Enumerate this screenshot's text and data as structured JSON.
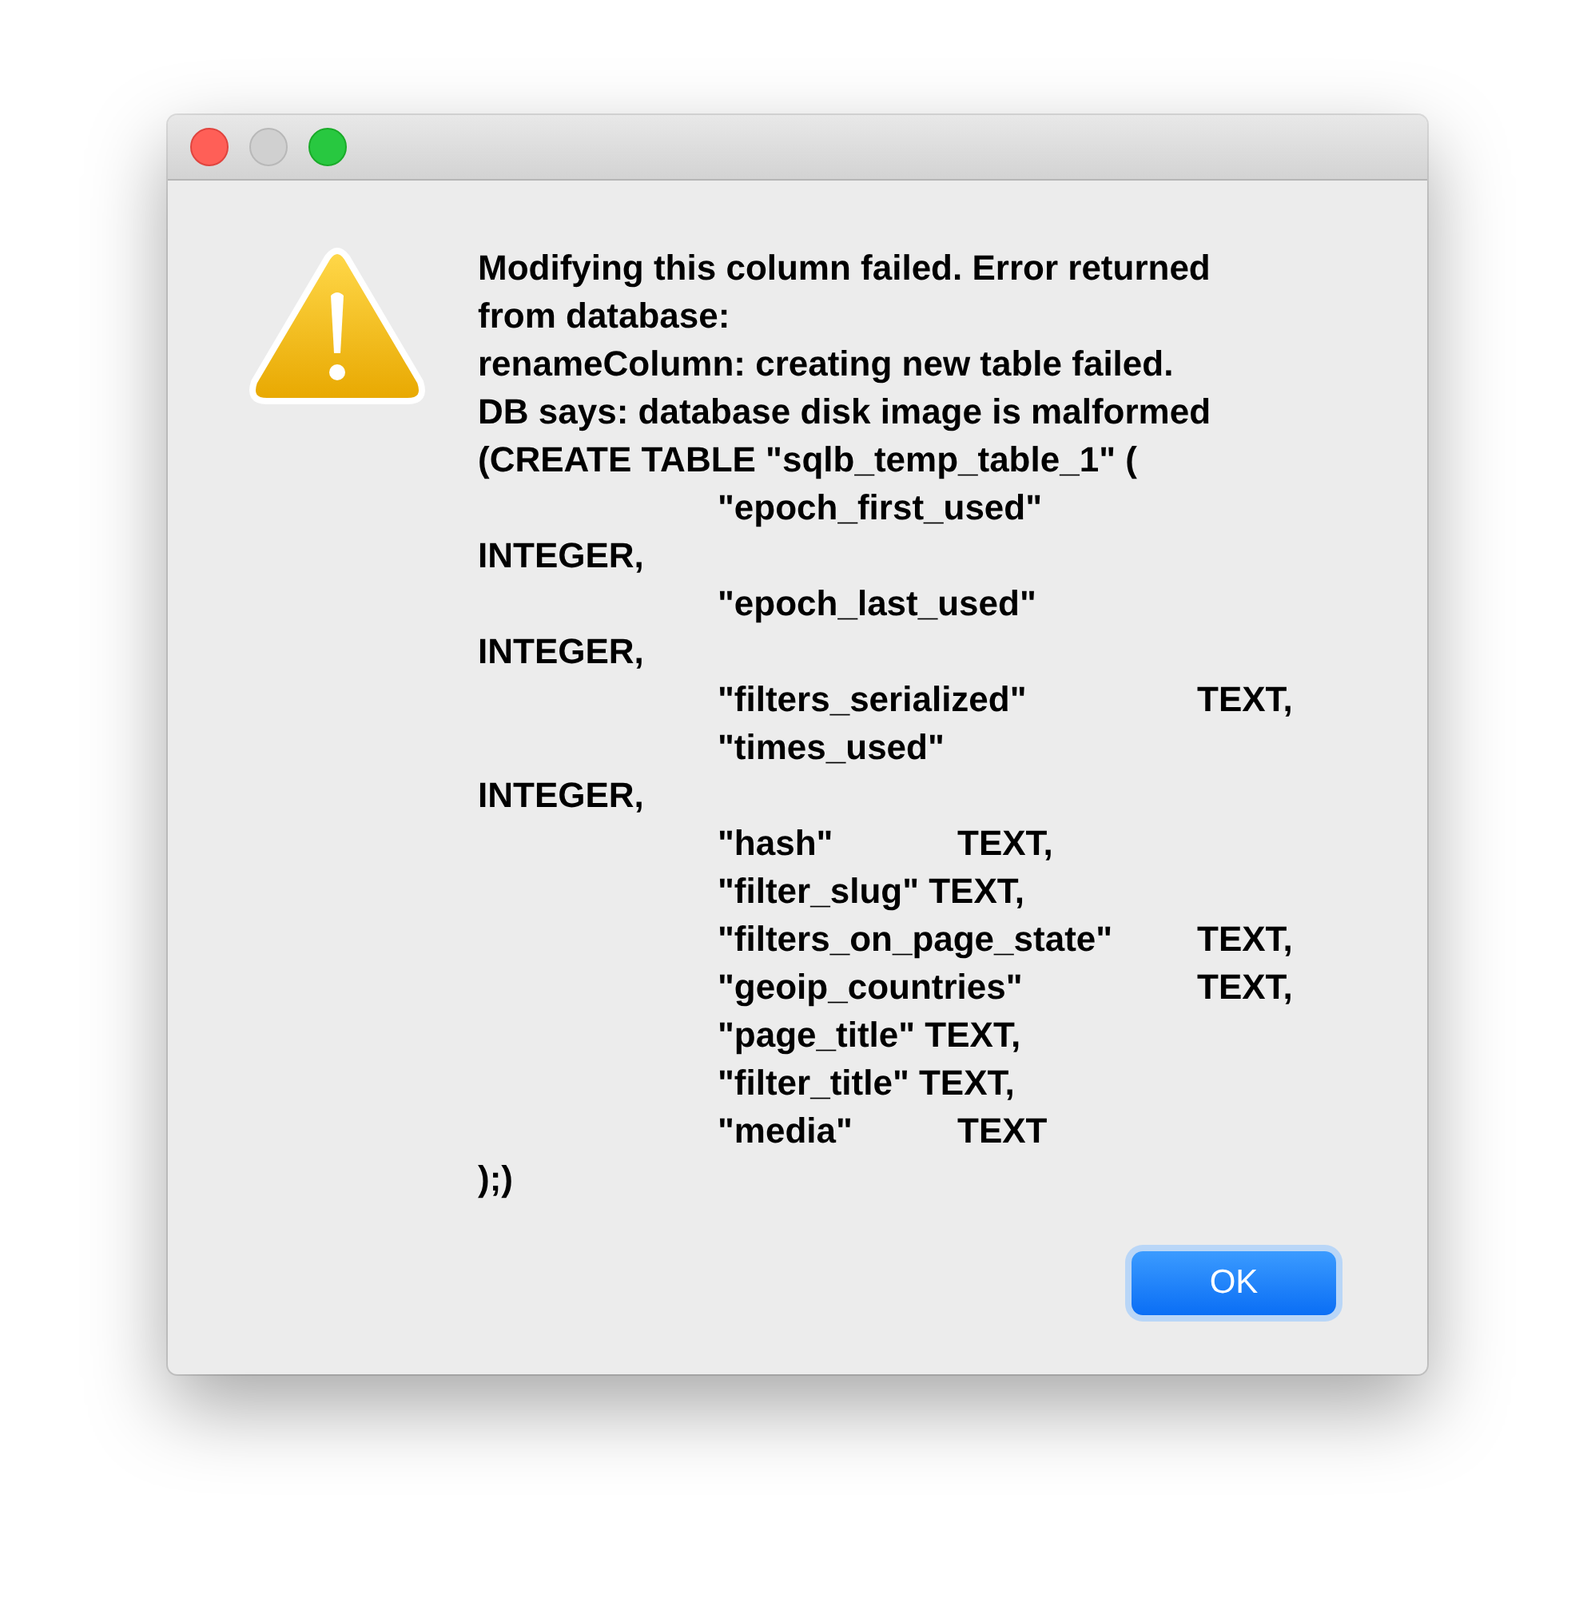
{
  "window": {
    "buttons": [
      {
        "kind": "close",
        "disabled": false
      },
      {
        "kind": "minimize",
        "disabled": true
      },
      {
        "kind": "zoom",
        "disabled": false
      }
    ]
  },
  "alert": {
    "message_lines": [
      "Modifying this column failed. Error returned",
      "from database:",
      "renameColumn: creating new table failed.",
      "DB says: database disk image is malformed",
      "(CREATE TABLE \"sqlb_temp_table_1\" (",
      "\t\"epoch_first_used\"",
      "INTEGER,",
      "\t\"epoch_last_used\"",
      "INTEGER,",
      "\t\"filters_serialized\"\tTEXT,",
      "\t\"times_used\"",
      "INTEGER,",
      "\t\"hash\"\tTEXT,",
      "\t\"filter_slug\" TEXT,",
      "\t\"filters_on_page_state\"\tTEXT,",
      "\t\"geoip_countries\"\tTEXT,",
      "\t\"page_title\" TEXT,",
      "\t\"filter_title\" TEXT,",
      "\t\"media\"\tTEXT",
      ");)"
    ],
    "button": {
      "label": "OK"
    }
  }
}
